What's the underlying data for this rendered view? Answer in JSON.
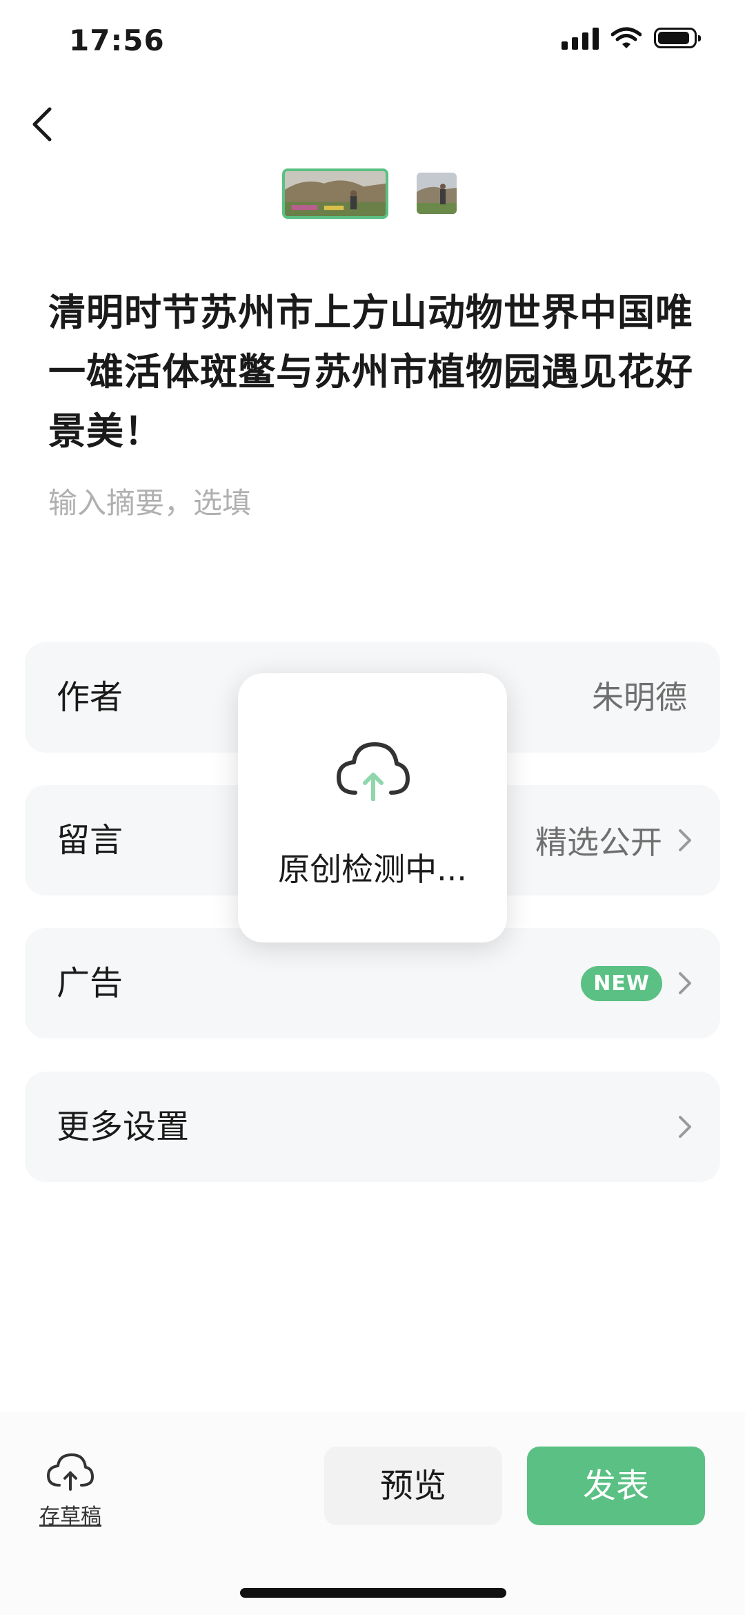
{
  "status_bar": {
    "time": "17:56"
  },
  "title": "清明时节苏州市上方山动物世界中国唯一雄活体斑鳖与苏州市植物园遇见花好景美！",
  "summary_placeholder": "输入摘要，选填",
  "rows": {
    "author": {
      "label": "作者",
      "value": "朱明德"
    },
    "comments": {
      "label": "留言",
      "value": "精选公开"
    },
    "ads": {
      "label": "广告",
      "badge": "NEW"
    },
    "more": {
      "label": "更多设置"
    }
  },
  "toast": {
    "text": "原创检测中...",
    "icon": "cloud-upload-icon"
  },
  "bottom_bar": {
    "draft_label": "存草稿",
    "preview_label": "预览",
    "publish_label": "发表"
  },
  "colors": {
    "accent": "#5ac083",
    "row_bg": "#f6f7f8"
  }
}
